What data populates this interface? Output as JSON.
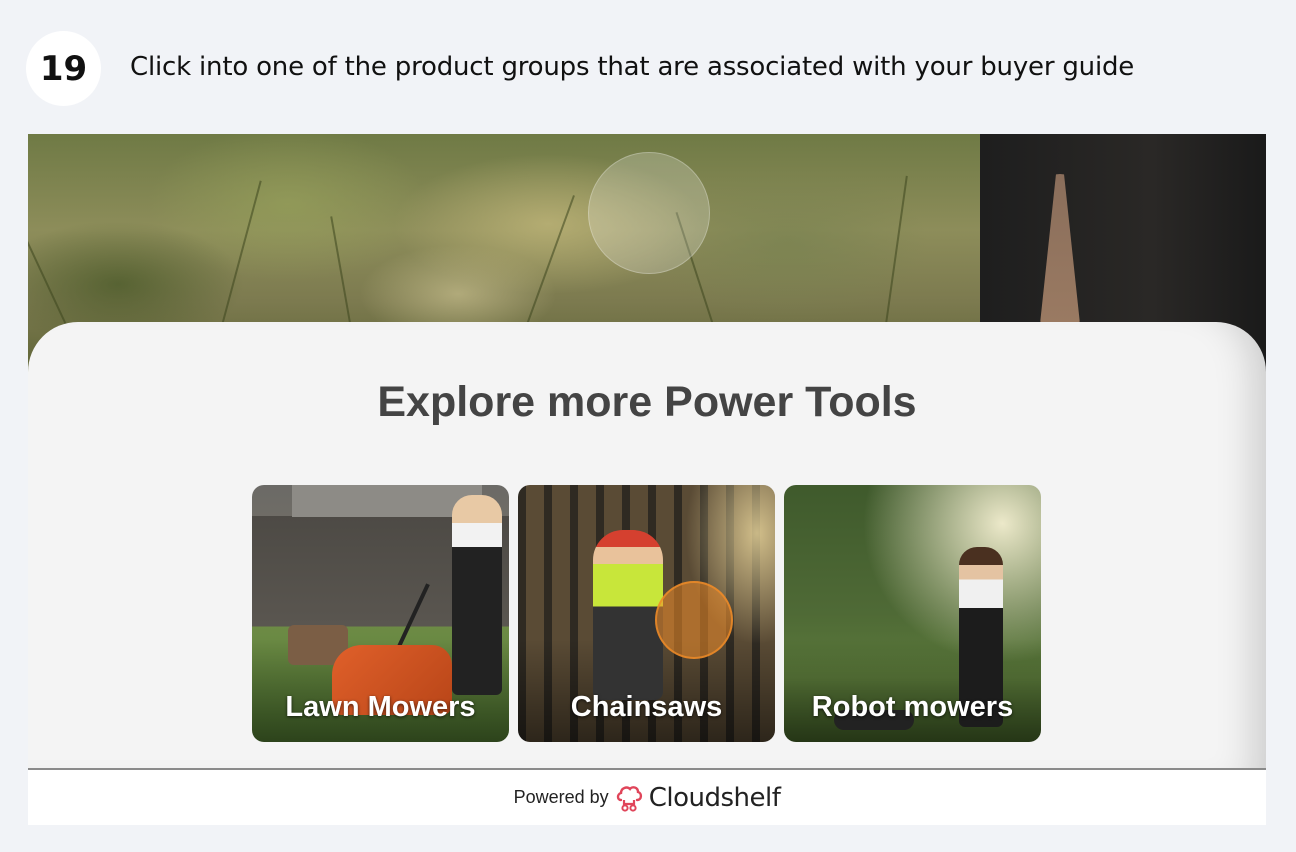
{
  "step": {
    "number": "19",
    "instruction": "Click into one of the product groups that are associated with your buyer guide"
  },
  "panel": {
    "title": "Explore more Power Tools"
  },
  "categories": [
    {
      "label": "Lawn Mowers"
    },
    {
      "label": "Chainsaws"
    },
    {
      "label": "Robot mowers"
    }
  ],
  "footer": {
    "powered_by": "Powered by",
    "brand": "Cloudshelf",
    "brand_icon": "cloudshelf-logo-icon",
    "brand_color": "#e0455a"
  }
}
